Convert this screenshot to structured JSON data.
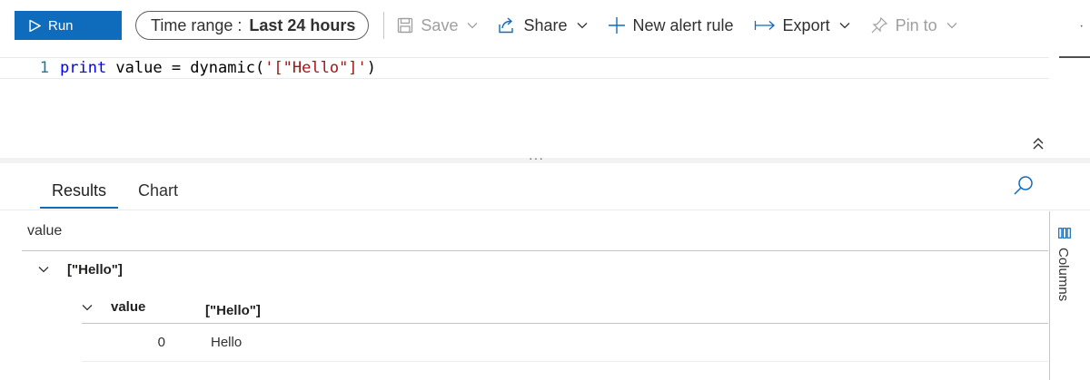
{
  "toolbar": {
    "run_label": "Run",
    "time_range_label": "Time range :",
    "time_range_value": "Last 24 hours",
    "save_label": "Save",
    "share_label": "Share",
    "new_alert_label": "New alert rule",
    "export_label": "Export",
    "pin_label": "Pin to",
    "more_label": "·"
  },
  "editor": {
    "line_number": "1",
    "code_keyword": "print",
    "code_plain": " value = dynamic(",
    "code_string": "'[\"Hello\"]'",
    "code_close": ")"
  },
  "splitter": {
    "dots": "···"
  },
  "results": {
    "tabs": [
      {
        "label": "Results"
      },
      {
        "label": "Chart"
      }
    ],
    "columns_panel_label": "Columns"
  },
  "grid": {
    "header": "value",
    "row_value": "[\"Hello\"]",
    "nested": {
      "col_name": "value",
      "col_value": "[\"Hello\"]",
      "rows": [
        {
          "index": "0",
          "value": "Hello"
        }
      ]
    }
  },
  "colors": {
    "accent": "#0f6cbd",
    "disabled": "#a19f9d",
    "line_number": "#237893",
    "keyword": "#0000ff",
    "string": "#a31515"
  }
}
